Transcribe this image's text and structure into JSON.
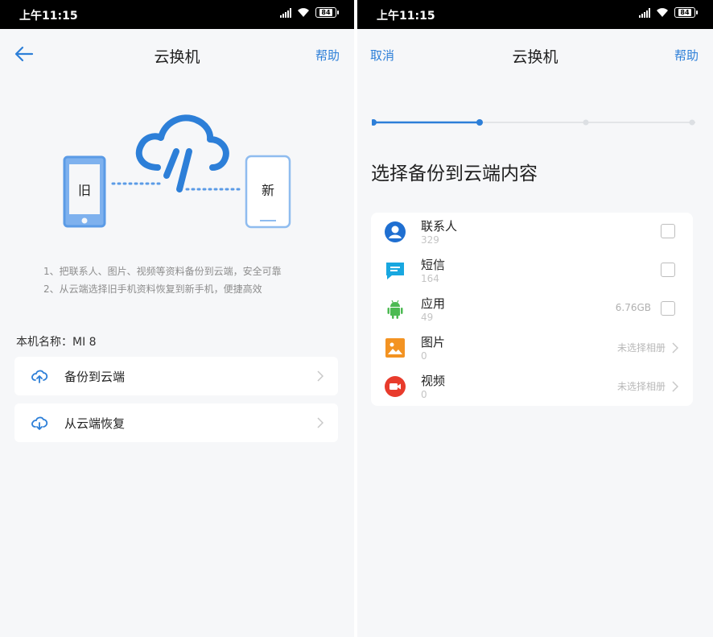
{
  "left": {
    "status": {
      "time": "上午11:15",
      "battery": "84"
    },
    "nav": {
      "title": "云换机",
      "help": "帮助"
    },
    "illustration": {
      "old_label": "旧",
      "new_label": "新"
    },
    "description": [
      "1、把联系人、图片、视频等资料备份到云端，安全可靠",
      "2、从云端选择旧手机资料恢复到新手机，便捷高效"
    ],
    "device_name": "本机名称：MI 8",
    "menu": [
      {
        "label": "备份到云端",
        "icon": "cloud-upload-icon"
      },
      {
        "label": "从云端恢复",
        "icon": "cloud-download-icon"
      }
    ]
  },
  "right": {
    "status": {
      "time": "上午11:15",
      "battery": "84"
    },
    "nav": {
      "cancel": "取消",
      "title": "云换机",
      "help": "帮助"
    },
    "stepper": {
      "current_step": 2,
      "total_steps": 4
    },
    "heading": "选择备份到云端内容",
    "items": [
      {
        "name": "联系人",
        "count": "329",
        "icon": "contact-icon",
        "color": "#1f6fd1"
      },
      {
        "name": "短信",
        "count": "164",
        "icon": "message-icon",
        "color": "#18a7e0"
      },
      {
        "name": "应用",
        "count": "49",
        "size": "6.76GB",
        "icon": "android-icon",
        "color": "#4cba52"
      },
      {
        "name": "图片",
        "count": "0",
        "hint": "未选择相册",
        "icon": "image-icon",
        "color": "#f39322"
      },
      {
        "name": "视频",
        "count": "0",
        "hint": "未选择相册",
        "icon": "video-icon",
        "color": "#e83b2c"
      }
    ]
  },
  "colors": {
    "accent": "#2d7fd8",
    "illustration": "#5b9be6"
  }
}
